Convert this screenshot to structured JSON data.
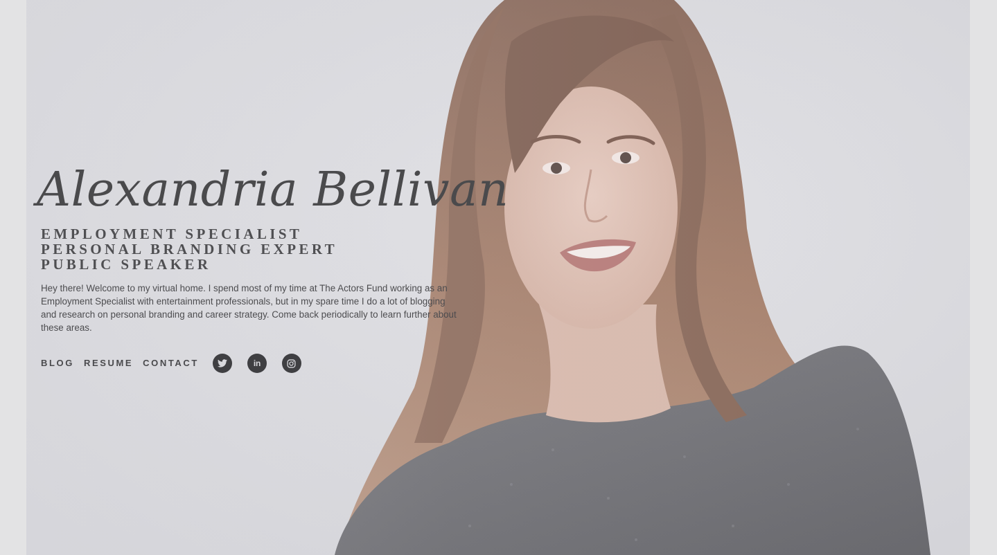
{
  "profile": {
    "name": "Alexandria Bellivan",
    "titles": [
      "EMPLOYMENT SPECIALIST",
      "PERSONAL BRANDING EXPERT",
      "PUBLIC SPEAKER"
    ],
    "intro": "Hey there! Welcome to my virtual home. I spend most of my time at The Actors Fund working as an Employment Specialist with entertainment professionals, but in my spare time I do a lot of blogging and research on personal branding and career strategy. Come back periodically to learn further about these areas."
  },
  "nav": {
    "blog": "BLOG",
    "resume": "RESUME",
    "contact": "CONTACT"
  },
  "social": [
    "twitter-icon",
    "linkedin-icon",
    "instagram-icon"
  ],
  "colors": {
    "background": "#e2e2e3",
    "text": "#4a4a4c",
    "icon_circle": "#3f3f42"
  }
}
